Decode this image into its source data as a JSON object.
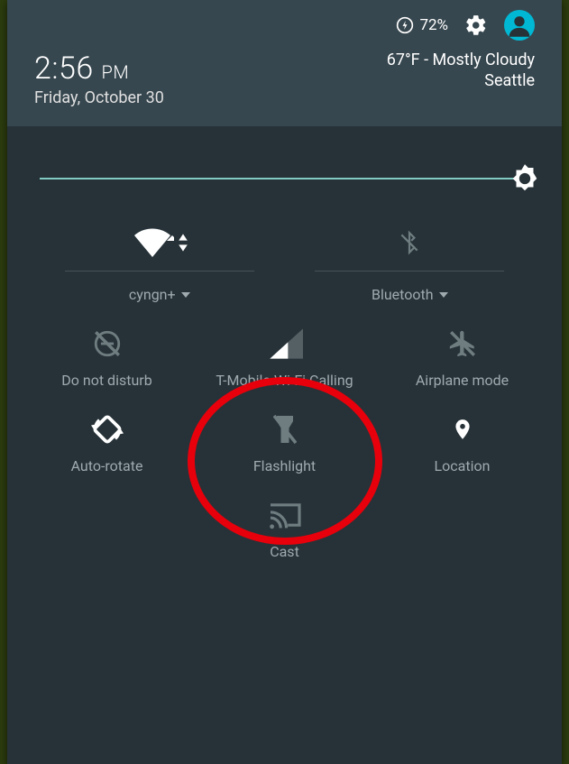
{
  "status": {
    "battery_percent": "72%"
  },
  "clock": {
    "time": "2:56",
    "ampm": "PM",
    "date": "Friday, October 30"
  },
  "weather": {
    "summary": "67°F - Mostly Cloudy",
    "city": "Seattle"
  },
  "tiles": {
    "wifi": {
      "label": "cyngn+"
    },
    "bluetooth": {
      "label": "Bluetooth"
    },
    "dnd": {
      "label": "Do not disturb"
    },
    "cellular": {
      "label": "T-Mobile Wi-Fi Calling"
    },
    "airplane": {
      "label": "Airplane mode"
    },
    "rotate": {
      "label": "Auto-rotate"
    },
    "flashlight": {
      "label": "Flashlight"
    },
    "location": {
      "label": "Location"
    },
    "cast": {
      "label": "Cast"
    }
  },
  "colors": {
    "accent": "#80CBC4",
    "avatar": "#00B8D4",
    "highlight": "#E7000B"
  }
}
